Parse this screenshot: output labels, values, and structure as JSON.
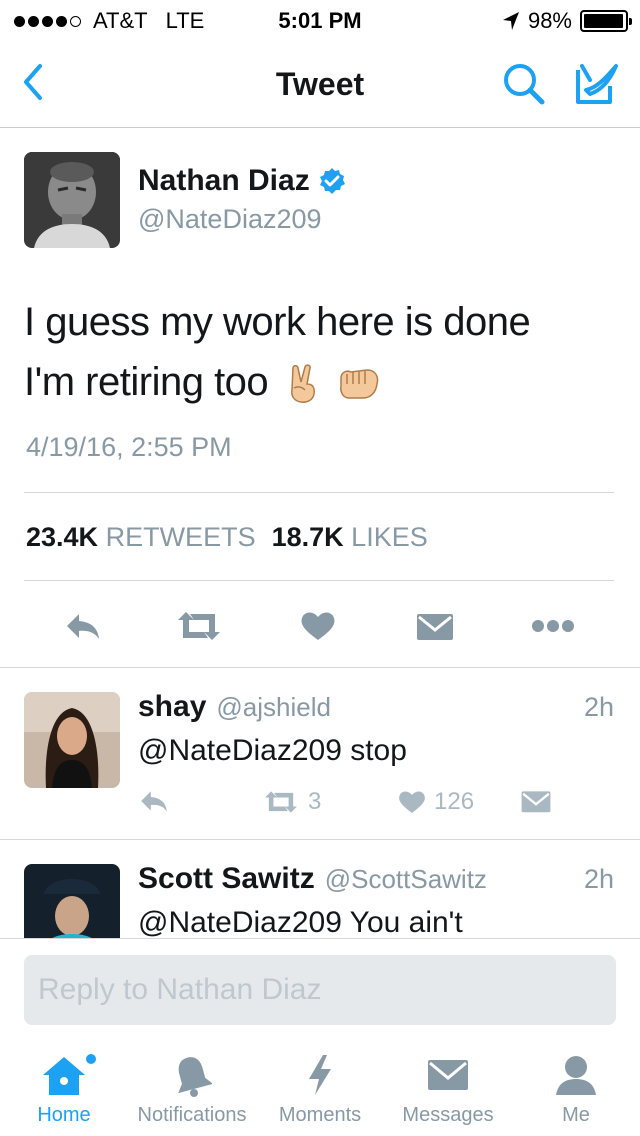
{
  "status_bar": {
    "carrier": "AT&T",
    "network": "LTE",
    "time": "5:01 PM",
    "battery": "98%",
    "battery_level": 0.98,
    "signal_bars_filled": 4,
    "signal_bars_total": 5
  },
  "nav": {
    "title": "Tweet",
    "back_icon": "chevron-left-icon",
    "search_icon": "search-icon",
    "compose_icon": "compose-icon"
  },
  "tweet": {
    "author_name": "Nathan Diaz",
    "author_handle": "@NateDiaz209",
    "verified": true,
    "text_line1": "I guess my work here is done",
    "text_line2": "I'm retiring too",
    "emojis": [
      "victory-hand-emoji",
      "fist-bump-emoji"
    ],
    "timestamp": "4/19/16, 2:55 PM",
    "retweets_count": "23.4K",
    "retweets_label": "RETWEETS",
    "likes_count": "18.7K",
    "likes_label": "LIKES",
    "actions": [
      "reply-icon",
      "retweet-icon",
      "like-icon",
      "message-icon",
      "more-icon"
    ]
  },
  "replies": [
    {
      "name": "shay",
      "handle": "@ajshield",
      "time": "2h",
      "text": "@NateDiaz209 stop",
      "retweet_count": "3",
      "like_count": "126"
    },
    {
      "name": "Scott Sawitz",
      "handle": "@ScottSawitz",
      "time": "2h",
      "text": "@NateDiaz209 You ain't"
    }
  ],
  "composer": {
    "placeholder": "Reply to Nathan Diaz"
  },
  "tabbar": {
    "tabs": [
      {
        "label": "Home",
        "icon": "home-icon"
      },
      {
        "label": "Notifications",
        "icon": "bell-icon"
      },
      {
        "label": "Moments",
        "icon": "lightning-icon"
      },
      {
        "label": "Messages",
        "icon": "envelope-icon"
      },
      {
        "label": "Me",
        "icon": "person-icon"
      }
    ],
    "active": "Home"
  },
  "colors": {
    "accent": "#1da1f2",
    "text_primary": "#14171a",
    "text_secondary": "#8899a6",
    "icon_gray": "#8899a6",
    "reply_icon_gray": "#aab8c2"
  }
}
